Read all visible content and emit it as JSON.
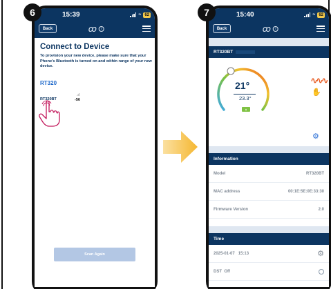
{
  "left_phone": {
    "step": "6",
    "status": {
      "time": "15:39",
      "battery": "62"
    },
    "nav": {
      "back_label": "Back",
      "info_glyph": "i"
    },
    "title": "Connect to Device",
    "description": "To provision your new device, please make sure that your Phone's Bluetooth is turned on and within range of your new device.",
    "section_header": "RT320",
    "device": {
      "name": "RT320BT",
      "rssi": "-56"
    },
    "scan_button": "Scan Again"
  },
  "right_phone": {
    "step": "7",
    "status": {
      "time": "15:40",
      "battery": "62"
    },
    "nav": {
      "back_label": "Back",
      "info_glyph": "i"
    },
    "device_card": {
      "title": "RT320BT",
      "current_temp": "21°",
      "set_temp": "23.3°",
      "heat_icon": "heat-waves-icon",
      "manual_icon": "hand-icon"
    },
    "information": {
      "header": "Information",
      "rows": [
        {
          "label": "Model",
          "value": "RT320BT"
        },
        {
          "label": "MAC address",
          "value": "00:1E:5E:0E:33:30"
        },
        {
          "label": "Firmware Version",
          "value": "2.0"
        }
      ]
    },
    "time_section": {
      "header": "Time",
      "date": "2025-01-07",
      "time": "15:13",
      "dst_label": "DST",
      "dst_value": "Off"
    }
  },
  "colors": {
    "navy": "#0c3561",
    "accent_blue": "#1b66c9",
    "arrow": "#f5b731",
    "scan_button": "#b3c7e4"
  }
}
